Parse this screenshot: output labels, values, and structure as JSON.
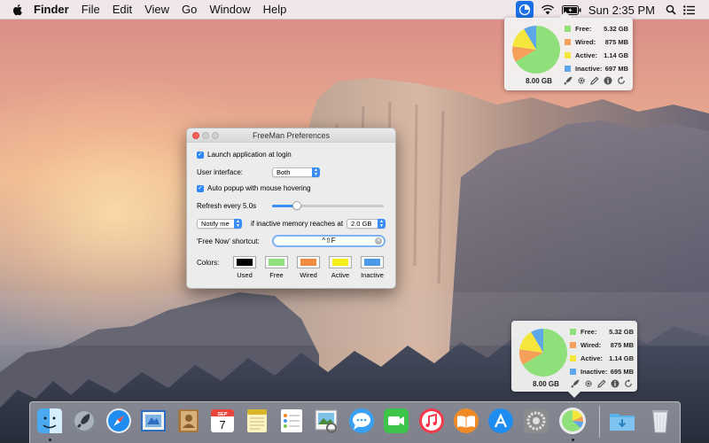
{
  "menubar": {
    "apple": "apple-icon",
    "app": "Finder",
    "items": [
      "File",
      "Edit",
      "View",
      "Go",
      "Window",
      "Help"
    ],
    "clock": "Sun 2:35 PM",
    "tray_icons": [
      "freeman-icon",
      "wifi-icon",
      "battery-icon",
      "search-icon",
      "list-icon"
    ]
  },
  "popover_top": {
    "total": "8.00 GB",
    "legend": [
      {
        "label": "Free:",
        "value": "5.32 GB",
        "color": "#8fe07a"
      },
      {
        "label": "Wired:",
        "value": "875 MB",
        "color": "#f5a05a"
      },
      {
        "label": "Active:",
        "value": "1.14 GB",
        "color": "#f5e63c"
      },
      {
        "label": "Inactive:",
        "value": "697 MB",
        "color": "#5ea6ea"
      }
    ],
    "icons": [
      "rocket-icon",
      "gear-icon",
      "pencil-icon",
      "info-icon",
      "refresh-icon"
    ]
  },
  "popover_bottom": {
    "total": "8.00 GB",
    "legend": [
      {
        "label": "Free:",
        "value": "5.32 GB",
        "color": "#8fe07a"
      },
      {
        "label": "Wired:",
        "value": "875 MB",
        "color": "#f5a05a"
      },
      {
        "label": "Active:",
        "value": "1.14 GB",
        "color": "#f5e63c"
      },
      {
        "label": "Inactive:",
        "value": "695 MB",
        "color": "#5ea6ea"
      }
    ],
    "icons": [
      "rocket-icon",
      "gear-icon",
      "pencil-icon",
      "info-icon",
      "refresh-icon"
    ]
  },
  "prefs": {
    "title": "FreeMan Preferences",
    "launch_label": "Launch application at login",
    "launch_checked": true,
    "ui_label": "User interface:",
    "ui_value": "Both",
    "popup_label": "Auto popup with mouse hovering",
    "popup_checked": true,
    "refresh_label": "Refresh every 5.0s",
    "refresh_fraction": 0.22,
    "notify_value": "Notify me",
    "inactive_label": "if inactive memory reaches at",
    "threshold_value": "2.0 GB",
    "shortcut_label": "'Free Now' shortcut:",
    "shortcut_value": "^⇧F",
    "colors_label": "Colors:",
    "colors": [
      {
        "name": "Used",
        "color": "#000000"
      },
      {
        "name": "Free",
        "color": "#8fe07a"
      },
      {
        "name": "Wired",
        "color": "#f08a3c"
      },
      {
        "name": "Active",
        "color": "#f5ee1a"
      },
      {
        "name": "Inactive",
        "color": "#4a9ae8"
      }
    ]
  },
  "dock": {
    "apps": [
      "finder-icon",
      "launchpad-icon",
      "safari-icon",
      "mail-icon",
      "contacts-icon",
      "calendar-icon",
      "notes-icon",
      "reminders-icon",
      "preview-icon",
      "messages-icon",
      "facetime-icon",
      "itunes-icon",
      "ibooks-icon",
      "app-store-icon",
      "system-preferences-icon",
      "freeman-dock-icon",
      "downloads-folder-icon",
      "trash-icon"
    ],
    "calendar_month": "SEP",
    "calendar_day": "7"
  }
}
